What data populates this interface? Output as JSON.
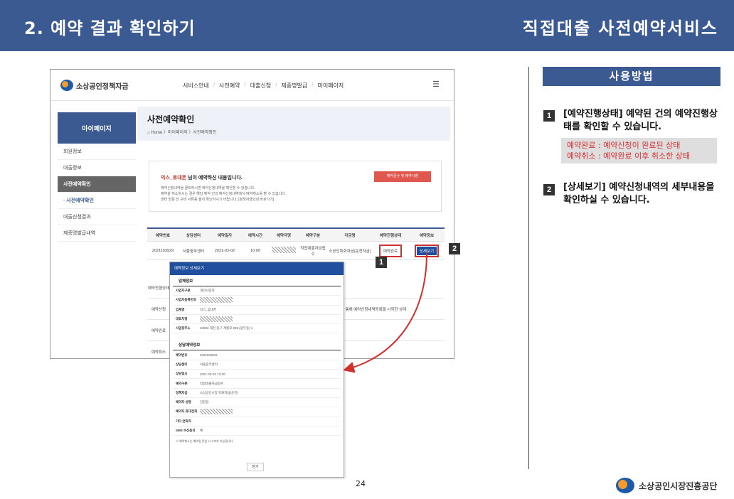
{
  "header": {
    "title": "2. 예약 결과 확인하기",
    "service": "직접대출 사전예약서비스"
  },
  "site": {
    "logo": "소상공인정책자금",
    "menu": [
      "서비스안내",
      "사전예약",
      "대출신청",
      "제증명발급",
      "마이페이지"
    ],
    "sidebar_title": "마이페이지",
    "sidebar_items": [
      "회원정보",
      "대출정보",
      "사전예약확인",
      "· 사전예약확인",
      "대출신청결과",
      "제증명발급내역"
    ]
  },
  "banner": {
    "title": "사전예약확인",
    "crumb": "Home 〉마이페이지 〉사전예약확인"
  },
  "notice": {
    "name": "익스_휴대폰",
    "title_suffix": " 님이 예약하신 내용입니다.",
    "lines": [
      "예약신청내역을 클릭하시면 예약신청내역을 확인할 수 있습니다.",
      "예약을 취소하시는 경우 해당 예약 건의 예약신청내역에서 예약취소를 할 수 있습니다.",
      "센터 방문 전 구비 서류를 필히 확인하시기 바랍니다. [정책자금안내 바로가기]"
    ],
    "button": "예약준수 및 제약사항"
  },
  "table": {
    "headers": [
      "예약번호",
      "상담센터",
      "예약일자",
      "예약시간",
      "예약자명",
      "예약구분",
      "자금명",
      "예약진행상태",
      "예약정보"
    ],
    "row": [
      "2021103929",
      "서울중부센터",
      "2021-03-02",
      "10:00",
      "",
      "직접대출자금접수",
      "소공인특화자금(운전자금)",
      "예약완료",
      "상세보기"
    ]
  },
  "table2": {
    "rows": [
      {
        "left": "예약진행상태",
        "right": ""
      },
      {
        "left": "예약신청",
        "right": "을 통해 예약신청내역등록을 시작한 상태"
      },
      {
        "left": "예약완료",
        "right": ""
      },
      {
        "left": "예약취소",
        "right": ""
      }
    ]
  },
  "popup": {
    "title": "예약정보 상세보기",
    "sec1": "업체정보",
    "sec1_rows": [
      {
        "label": "사업자구분",
        "value": "개인사업자"
      },
      {
        "label": "사업자등록번호",
        "value": ""
      },
      {
        "label": "업체명",
        "value": "익스_휴대폰"
      },
      {
        "label": "대표자명",
        "value": ""
      },
      {
        "label": "사업장주소",
        "value": "34502 대전 중구 계룡로 825 (용두동) 1"
      }
    ],
    "sec2": "상담예약정보",
    "sec2_rows": [
      {
        "label": "예약번호",
        "value": "2021103934"
      },
      {
        "label": "상담센터",
        "value": "서울중부센터"
      },
      {
        "label": "상담일시",
        "value": "2021-03-02 13:30"
      },
      {
        "label": "예약구분",
        "value": "직접대출자금접수"
      },
      {
        "label": "정책자금",
        "value": "소상공인시장 특화자금(운전)"
      },
      {
        "label": "예약자 성명",
        "value": "김원길"
      },
      {
        "label": "예약자 휴대전화",
        "value": ""
      },
      {
        "label": "기타 연락처",
        "value": ""
      },
      {
        "label": "SMS 수신동의",
        "value": "예"
      }
    ],
    "note": "※ 예약취소는 예약일 전날 17시까지 가능합니다.",
    "close": "닫기"
  },
  "callouts": {
    "one": "1",
    "two": "2"
  },
  "usage": {
    "title": "사용방법",
    "step1": "[예약진행상태] 예약된 건의 예약진행상태를 확인할 수 있습니다.",
    "note1": "예약완료 : 예약신청이 완료된 상태",
    "note2": "예약취소 : 예약완료 이후 취소한 상태",
    "step2": "[상세보기] 예약신청내역의 세부내용을 확인하실 수 있습니다."
  },
  "page_number": "24",
  "footer": "소상공인시장진흥공단",
  "colors": {
    "header": "#3b5a92",
    "accent_red": "#d32f2f",
    "button_blue": "#1f4f9e"
  }
}
